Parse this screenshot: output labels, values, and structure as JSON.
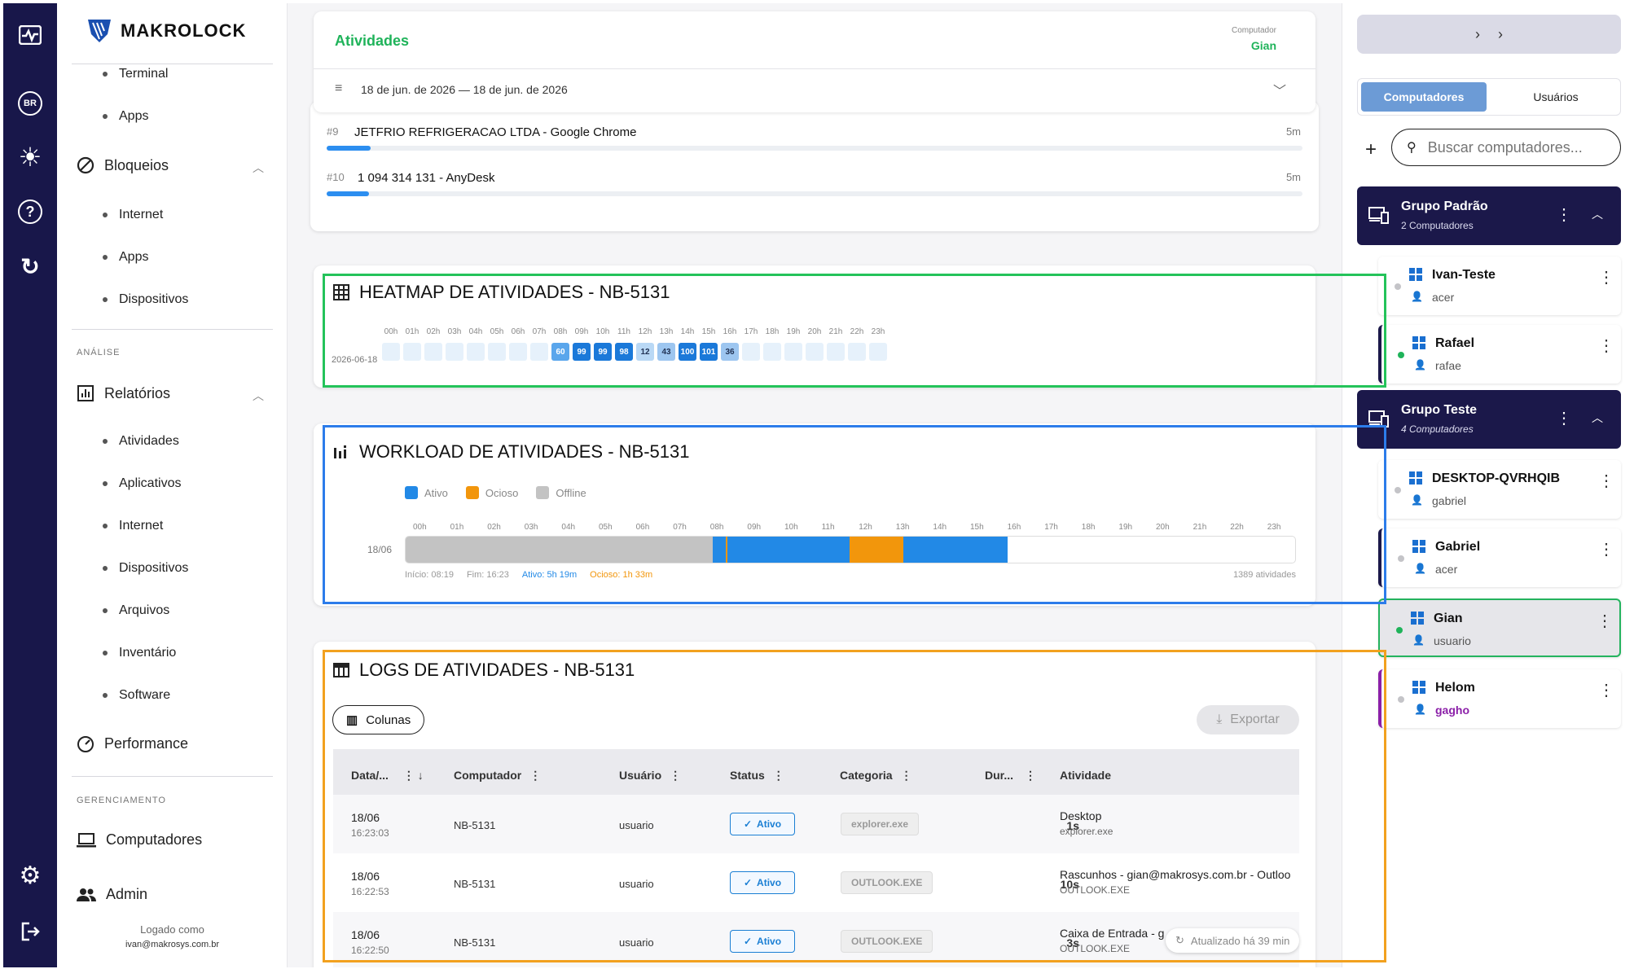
{
  "brand": {
    "name": "MAKROLOCK"
  },
  "rail": {
    "lang": "BR"
  },
  "nav": {
    "top_items": [
      "Terminal",
      "Apps"
    ],
    "bloqueios": {
      "label": "Bloqueios",
      "items": [
        "Internet",
        "Apps",
        "Dispositivos"
      ]
    },
    "analise_caption": "ANÁLISE",
    "relatorios": {
      "label": "Relatórios",
      "items": [
        "Atividades",
        "Aplicativos",
        "Internet",
        "Dispositivos",
        "Arquivos",
        "Inventário",
        "Software"
      ]
    },
    "performance": "Performance",
    "gerenciamento_caption": "GERENCIAMENTO",
    "computadores": "Computadores",
    "admin": "Admin",
    "logged_as": "Logado como",
    "user_email": "ivan@makrosys.com.br"
  },
  "header": {
    "title": "Atividades",
    "computer_caption": "Computador",
    "computer_value": "Gian",
    "date_range": "18 de jun. de 2026 — 18 de jun. de 2026"
  },
  "top_list": [
    {
      "rank": "#9",
      "name": "JETFRIO REFRIGERACAO LTDA - Google Chrome",
      "dur": "5m",
      "fill": 0.045
    },
    {
      "rank": "#10",
      "name": "1 094 314 131 - AnyDesk",
      "dur": "5m",
      "fill": 0.043
    }
  ],
  "heatmap": {
    "title": "HEATMAP DE ATIVIDADES - NB-5131",
    "date": "2026-06-18",
    "hours": [
      "00h",
      "01h",
      "02h",
      "03h",
      "04h",
      "05h",
      "06h",
      "07h",
      "08h",
      "09h",
      "10h",
      "11h",
      "12h",
      "13h",
      "14h",
      "15h",
      "16h",
      "17h",
      "18h",
      "19h",
      "20h",
      "21h",
      "22h",
      "23h"
    ],
    "values": [
      null,
      null,
      null,
      null,
      null,
      null,
      null,
      null,
      60,
      99,
      99,
      98,
      12,
      43,
      100,
      101,
      36,
      null,
      null,
      null,
      null,
      null,
      null,
      null
    ]
  },
  "workload": {
    "title": "WORKLOAD DE ATIVIDADES - NB-5131",
    "legend": [
      "Ativo",
      "Ocioso",
      "Offline"
    ],
    "colors": {
      "ativo": "#2289e6",
      "ocioso": "#f2960c",
      "offline": "#c3c3c3"
    },
    "hours": [
      "00h",
      "01h",
      "02h",
      "03h",
      "04h",
      "05h",
      "06h",
      "07h",
      "08h",
      "09h",
      "10h",
      "11h",
      "12h",
      "13h",
      "14h",
      "15h",
      "16h",
      "17h",
      "18h",
      "19h",
      "20h",
      "21h",
      "22h",
      "23h"
    ],
    "row_label": "18/06",
    "inicio": "Início: 08:19",
    "fim": "Fim: 16:23",
    "ativo": "Ativo: 5h 19m",
    "ocioso": "Ocioso: 1h 33m",
    "count": "1389 atividades"
  },
  "logs": {
    "title": "LOGS DE ATIVIDADES - NB-5131",
    "columns_btn": "Colunas",
    "export_btn": "Exportar",
    "headers": [
      "Data/...",
      "Computador",
      "Usuário",
      "Status",
      "Categoria",
      "Dur...",
      "Atividade"
    ],
    "rows": [
      {
        "date": "18/06",
        "time": "16:23:03",
        "pc": "NB-5131",
        "user": "usuario",
        "status": "Ativo",
        "cat": "explorer.exe",
        "dur": "1s",
        "act": "Desktop",
        "act_sub": "explorer.exe"
      },
      {
        "date": "18/06",
        "time": "16:22:53",
        "pc": "NB-5131",
        "user": "usuario",
        "status": "Ativo",
        "cat": "OUTLOOK.EXE",
        "dur": "10s",
        "act": "Rascunhos - gian@makrosys.com.br - Outloo",
        "act_sub": "OUTLOOK.EXE"
      },
      {
        "date": "18/06",
        "time": "16:22:50",
        "pc": "NB-5131",
        "user": "usuario",
        "status": "Ativo",
        "cat": "OUTLOOK.EXE",
        "dur": "3s",
        "act": "Caixa de Entrada - g",
        "act_sub": "OUTLOOK.EXE"
      }
    ],
    "updated": "Atualizado há 39 min"
  },
  "right": {
    "tabs": [
      "Computadores",
      "Usuários"
    ],
    "search_placeholder": "Buscar computadores...",
    "groups": [
      {
        "name": "Grupo Padrão",
        "count": "2 Computadores",
        "pcs": [
          {
            "name": "Ivan-Teste",
            "user": "acer"
          },
          {
            "name": "Rafael",
            "user": "rafae"
          }
        ]
      },
      {
        "name": "Grupo Teste",
        "count": "4 Computadores",
        "pcs": [
          {
            "name": "DESKTOP-QVRHQIB",
            "user": "gabriel"
          },
          {
            "name": "Gabriel",
            "user": "acer"
          },
          {
            "name": "Gian",
            "user": "usuario"
          },
          {
            "name": "Helom",
            "user": "gagho"
          }
        ]
      }
    ]
  }
}
